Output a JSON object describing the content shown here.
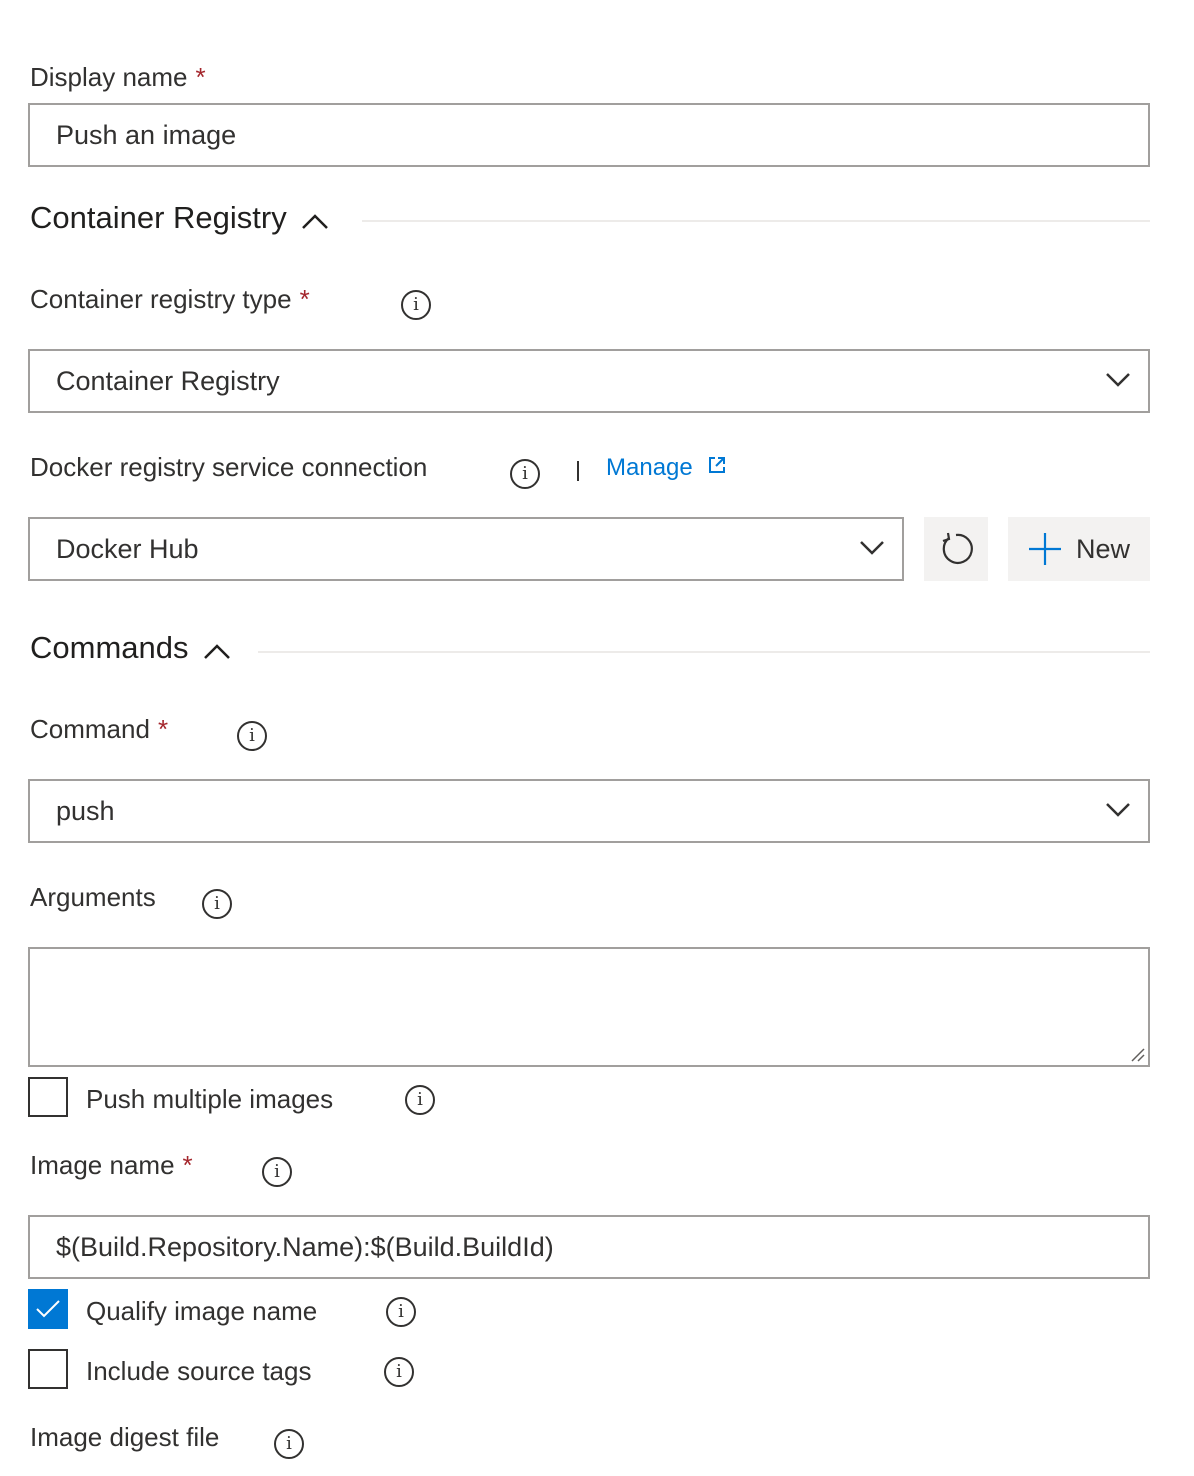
{
  "display_name": {
    "label": "Display name",
    "required_mark": "*",
    "value": "Push an image"
  },
  "container_registry_section": {
    "title": "Container Registry",
    "registry_type": {
      "label": "Container registry type",
      "required_mark": "*",
      "selected": "Container Registry"
    },
    "service_connection": {
      "label": "Docker registry service connection",
      "manage_link": "Manage",
      "selected": "Docker Hub",
      "new_button": "New"
    }
  },
  "commands_section": {
    "title": "Commands",
    "command": {
      "label": "Command",
      "required_mark": "*",
      "selected": "push"
    },
    "arguments": {
      "label": "Arguments",
      "value": ""
    },
    "push_multiple_images": {
      "label": "Push multiple images",
      "checked": false
    },
    "image_name": {
      "label": "Image name",
      "required_mark": "*",
      "value": "$(Build.Repository.Name):$(Build.BuildId)"
    },
    "qualify_image_name": {
      "label": "Qualify image name",
      "checked": true
    },
    "include_source_tags": {
      "label": "Include source tags",
      "checked": false
    },
    "image_digest_file": {
      "label": "Image digest file"
    }
  },
  "colors": {
    "accent": "#0078d4",
    "required": "#a4262c",
    "border": "#a19f9d",
    "text": "#323130"
  },
  "icons": {
    "info": "info-icon",
    "chevron_down": "chevron-down-icon",
    "chevron_up": "chevron-up-icon",
    "refresh": "refresh-icon",
    "plus": "plus-icon",
    "external_link": "external-link-icon",
    "checkmark": "checkmark-icon"
  }
}
